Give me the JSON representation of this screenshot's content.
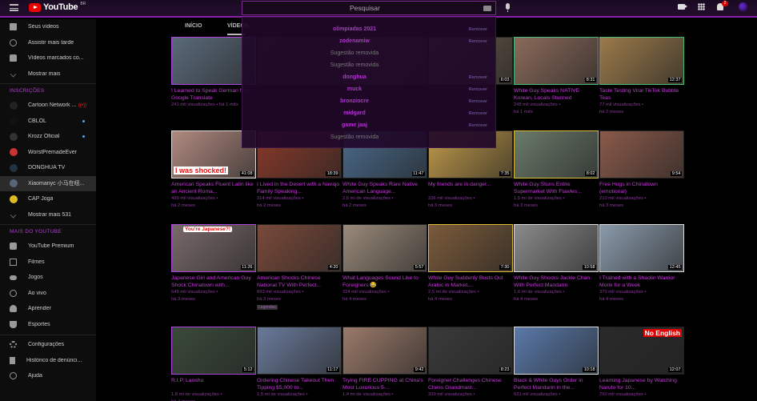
{
  "header": {
    "logo_text": "YouTube",
    "logo_region": "BR",
    "search_placeholder": "Pesquisar",
    "notif_count": "2"
  },
  "chips": [
    {
      "label": "INÍCIO"
    },
    {
      "label": "VÍDEOS"
    }
  ],
  "sidebar": {
    "top_items": [
      {
        "label": "Seus vídeos",
        "icon": "play-square-icon"
      },
      {
        "label": "Assistir mais tarde",
        "icon": "clock-icon"
      },
      {
        "label": "Vídeos marcados co...",
        "icon": "thumbs-up-icon"
      },
      {
        "label": "Mostrar mais",
        "icon": "chevron-down-icon"
      }
    ],
    "subs_heading": "INSCRIÇÕES",
    "subscriptions": [
      {
        "label": "Cartoon Network ...",
        "marker": "live",
        "color": "#222"
      },
      {
        "label": "CBLOL",
        "marker": "dot",
        "color": "#111"
      },
      {
        "label": "Krozz Oficial",
        "marker": "dot",
        "color": "#333"
      },
      {
        "label": "WorstPremadeEver",
        "marker": "",
        "color": "#c33"
      },
      {
        "label": "DONGHUA TV",
        "marker": "",
        "color": "#234"
      },
      {
        "label": "Xiaomanyc 小马在纽...",
        "marker": "",
        "color": "#567",
        "active": true
      },
      {
        "label": "CAP Joga",
        "marker": "",
        "color": "#db2"
      },
      {
        "label": "Mostrar mais 531",
        "marker": "",
        "color": ""
      }
    ],
    "more_heading": "MAIS DO YOUTUBE",
    "more_items": [
      {
        "label": "YouTube Premium",
        "icon": "youtube-premium-icon"
      },
      {
        "label": "Filmes",
        "icon": "film-icon"
      },
      {
        "label": "Jogos",
        "icon": "gamepad-icon"
      },
      {
        "label": "Ao vivo",
        "icon": "live-icon"
      },
      {
        "label": "Aprender",
        "icon": "lightbulb-icon"
      },
      {
        "label": "Esportes",
        "icon": "trophy-icon"
      }
    ],
    "bottom_items": [
      {
        "label": "Configurações",
        "icon": "gear-icon"
      },
      {
        "label": "Histórico de denúnci...",
        "icon": "flag-icon"
      },
      {
        "label": "Ajuda",
        "icon": "help-icon"
      }
    ]
  },
  "search_suggestions": [
    {
      "text": "olimpiadas 2021",
      "removable": true,
      "remove_label": "Remover"
    },
    {
      "text": "zodenamiw",
      "removable": true,
      "remove_label": "Remover"
    },
    {
      "text": "Sugestão removida",
      "removable": false,
      "remove_label": ""
    },
    {
      "text": "Sugestão removida",
      "removable": false,
      "remove_label": ""
    },
    {
      "text": "donghua",
      "removable": true,
      "remove_label": "Remover"
    },
    {
      "text": "muck",
      "removable": true,
      "remove_label": "Remover"
    },
    {
      "text": "bronziocre",
      "removable": true,
      "remove_label": "Remover"
    },
    {
      "text": "midgard",
      "removable": true,
      "remove_label": "Remover"
    },
    {
      "text": "game jaaj",
      "removable": true,
      "remove_label": "Remover"
    },
    {
      "text": "Sugestão removida",
      "removable": false,
      "remove_label": ""
    }
  ],
  "videos": [
    {
      "title": "I Learned to Speak German from Google Translate",
      "meta1": "241 mil visualizações • há 1 mês",
      "meta2": "",
      "duration": "",
      "bg": "#5a6a7a",
      "border": "t-b2"
    },
    {
      "title": "",
      "meta1": "",
      "meta2": "",
      "duration": "",
      "bg": "#333",
      "border": ""
    },
    {
      "title": "",
      "meta1": "",
      "meta2": "",
      "duration": "",
      "bg": "#444",
      "border": ""
    },
    {
      "title": "",
      "meta1": "",
      "meta2": "",
      "duration": "6:03",
      "bg": "#6a5a4a",
      "border": ""
    },
    {
      "title": "White Guy Speaks NATIVE Korean, Locals Stunned",
      "meta1": "245 mil visualizações •",
      "meta2": "há 1 mês",
      "duration": "8:31",
      "bg": "#8a6a5a",
      "border": "t-b1"
    },
    {
      "title": "Taste Testing Viral TikTok Bubble Teas",
      "meta1": "77 mil visualizações •",
      "meta2": "há 2 meses",
      "duration": "12:37",
      "bg": "#9a7a4a",
      "border": "t-b1"
    },
    {
      "title": "American Speaks Fluent Latin like an Ancient Roma...",
      "meta1": "499 mil visualizações •",
      "meta2": "há 2 meses",
      "duration": "41:08",
      "bg": "#b08a80",
      "border": "t-b3",
      "caption": "I was shocked!"
    },
    {
      "title": "I Lived in the Desert with a Navajo Family Speaking...",
      "meta1": "314 mil visualizações •",
      "meta2": "há 2 meses",
      "duration": "18:39",
      "bg": "#8a3a2a",
      "border": ""
    },
    {
      "title": "White Guy Speaks Rare Native American Language...",
      "meta1": "2,5 mi de visualizações •",
      "meta2": "há 2 meses",
      "duration": "11:47",
      "bg": "#4a6a8a",
      "border": ""
    },
    {
      "title": "My friends are in danger...",
      "meta1": "336 mil visualizações •",
      "meta2": "há 3 meses",
      "duration": "7:35",
      "bg": "#c09a4a",
      "border": ""
    },
    {
      "title": "White Guy Stuns Entire Supermarket With Flawles...",
      "meta1": "1,5 mi de visualizações •",
      "meta2": "há 3 meses",
      "duration": "8:02",
      "bg": "#6a7a6a",
      "border": "t-b4"
    },
    {
      "title": "Free Hugs in Chinatown (emotional)",
      "meta1": "210 mil visualizações •",
      "meta2": "há 3 meses",
      "duration": "9:54",
      "bg": "#8a5a4a",
      "border": ""
    },
    {
      "title": "Japanese Girl and American Guy Shock Chinatown with...",
      "meta1": "649 mil visualizações •",
      "meta2": "há 3 meses",
      "duration": "11:26",
      "bg": "#7a6a6a",
      "border": "t-b2",
      "caption": "You're Japanese?!"
    },
    {
      "title": "American Shocks Chinese National TV With Perfect...",
      "meta1": "893 mil visualizações •",
      "meta2": "há 3 meses",
      "duration": "4:20",
      "bg": "#7a4a3a",
      "border": "",
      "badge": "Legendas"
    },
    {
      "title": "What Languages Sound Like to Foreigners 😂",
      "meta1": "324 mil visualizações •",
      "meta2": "há 4 meses",
      "duration": "5:57",
      "bg": "#9a8a7a",
      "border": ""
    },
    {
      "title": "White Guy Suddenly Busts Out Arabic in Market,...",
      "meta1": "2,5 mi de visualizações •",
      "meta2": "há 4 meses",
      "duration": "7:30",
      "bg": "#7a5a3a",
      "border": "t-b4"
    },
    {
      "title": "White Guy Shocks Jackie Chan With Perfect Mandarin",
      "meta1": "1,6 mi de visualizações •",
      "meta2": "há 4 meses",
      "duration": "10:58",
      "bg": "#8a8a8a",
      "border": "t-b3"
    },
    {
      "title": "I Trained with a Shaolin Warrior Monk for a Week",
      "meta1": "370 mil visualizações •",
      "meta2": "há 4 meses",
      "duration": "12:45",
      "bg": "#8a9aaa",
      "border": "t-b3"
    },
    {
      "title": "R.I.P. Laoshu",
      "meta1": "1,8 mi de visualizações •",
      "meta2": "há 4 meses",
      "duration": "5:12",
      "bg": "#3a4a3a",
      "border": "t-b2"
    },
    {
      "title": "Ordering Chinese Takeout Then Tipping $5,000 to...",
      "meta1": "1,5 mi de visualizações •",
      "meta2": "",
      "duration": "11:17",
      "bg": "#6a7a9a",
      "border": ""
    },
    {
      "title": "Trying FIRE CUPPING at China's Most Luxurious 5-...",
      "meta1": "1,4 mi de visualizações •",
      "meta2": "",
      "duration": "9:42",
      "bg": "#9a7a6a",
      "border": ""
    },
    {
      "title": "Foreigner Challenges Chinese Chess Grandmast...",
      "meta1": "339 mil visualizações •",
      "meta2": "",
      "duration": "8:23",
      "bg": "#3a3a3a",
      "border": ""
    },
    {
      "title": "Black & White Guys Order in Perfect Mandarin in the...",
      "meta1": "621 mil visualizações •",
      "meta2": "",
      "duration": "10:18",
      "bg": "#5a7aaa",
      "border": "t-b3"
    },
    {
      "title": "Learning Japanese by Watching Naruto for 10...",
      "meta1": "750 mil visualizações •",
      "meta2": "",
      "duration": "12:07",
      "bg": "#2a2a2a",
      "border": "",
      "caption": "No English"
    }
  ]
}
